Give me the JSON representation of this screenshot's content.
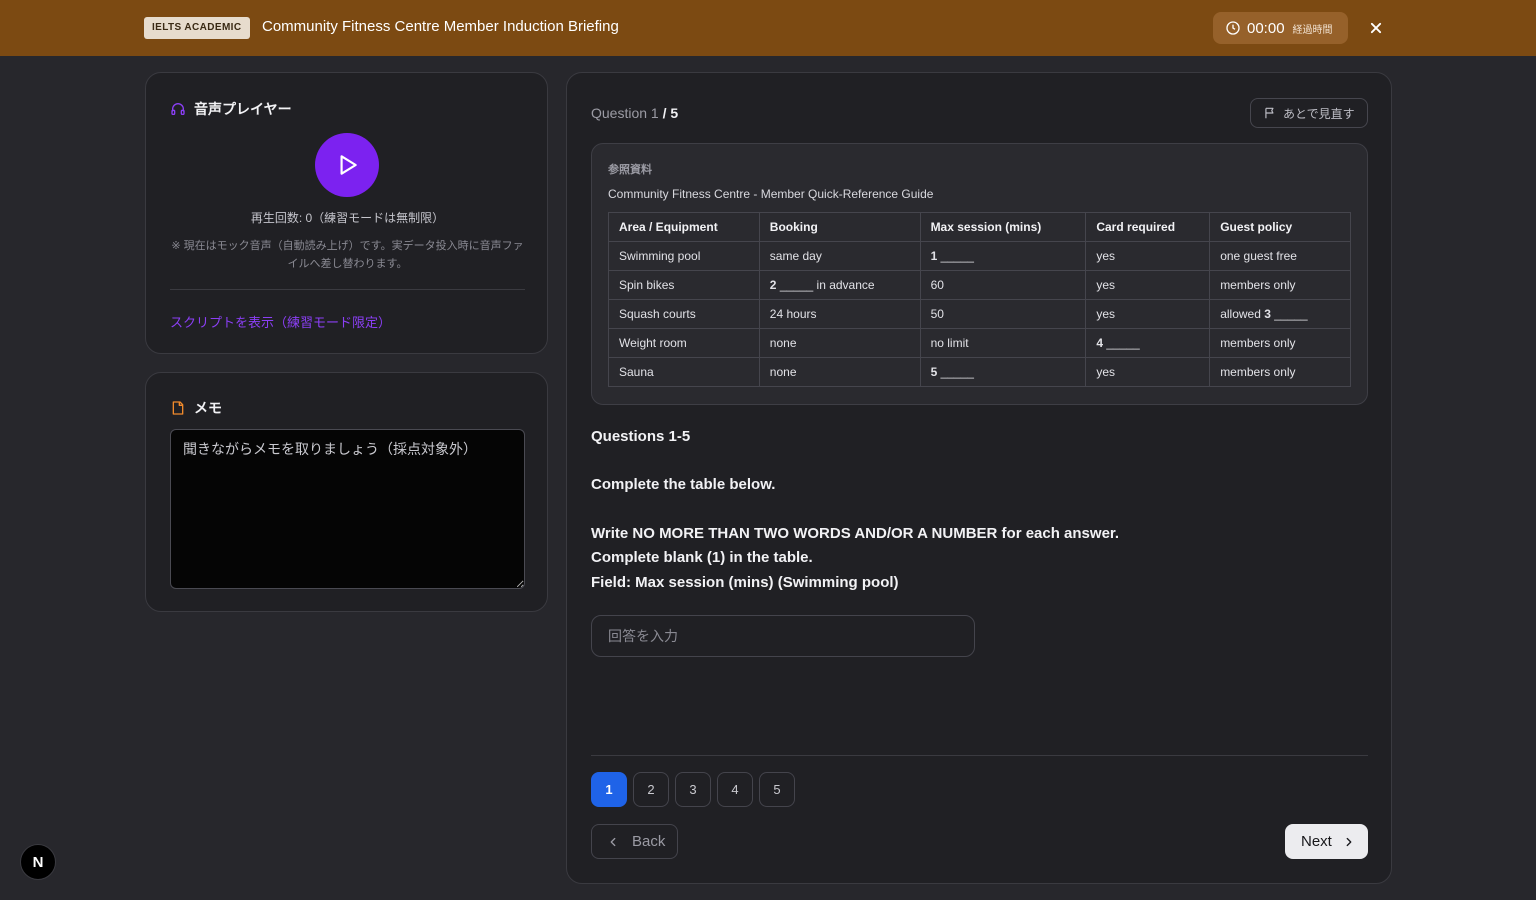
{
  "header": {
    "badge": "IELTS ACADEMIC",
    "title": "Community Fitness Centre Member Induction Briefing",
    "timer_value": "00:00",
    "timer_label": "経過時間"
  },
  "player": {
    "heading": "音声プレイヤー",
    "play_count": "再生回数: 0（練習モードは無制限）",
    "mock_note": "※ 現在はモック音声（自動読み上げ）です。実データ投入時に音声ファイルへ差し替わります。",
    "script_link": "スクリプトを表示（練習モード限定）"
  },
  "memo": {
    "heading": "メモ",
    "placeholder": "聞きながらメモを取りましょう（採点対象外）"
  },
  "question": {
    "counter_current": "Question 1",
    "counter_total": " / 5",
    "review_label": "あとで見直す",
    "reference_label": "参照資料",
    "reference_title": "Community Fitness Centre - Member Quick-Reference Guide",
    "table": {
      "headers": [
        "Area / Equipment",
        "Booking",
        "Max session (mins)",
        "Card required",
        "Guest policy"
      ],
      "rows": [
        [
          {
            "t": "Swimming pool"
          },
          {
            "t": "same day"
          },
          {
            "n": "1",
            "t": " _____"
          },
          {
            "t": "yes"
          },
          {
            "t": "one guest free"
          }
        ],
        [
          {
            "t": "Spin bikes"
          },
          {
            "n": "2",
            "t": " _____ in advance"
          },
          {
            "t": "60"
          },
          {
            "t": "yes"
          },
          {
            "t": "members only"
          }
        ],
        [
          {
            "t": "Squash courts"
          },
          {
            "t": "24 hours"
          },
          {
            "t": "50"
          },
          {
            "t": "yes"
          },
          {
            "p": "allowed ",
            "n": "3",
            "t": " _____"
          }
        ],
        [
          {
            "t": "Weight room"
          },
          {
            "t": "none"
          },
          {
            "t": "no limit"
          },
          {
            "n": "4",
            "t": " _____"
          },
          {
            "t": "members only"
          }
        ],
        [
          {
            "t": "Sauna"
          },
          {
            "t": "none"
          },
          {
            "n": "5",
            "t": " _____"
          },
          {
            "t": "yes"
          },
          {
            "t": "members only"
          }
        ]
      ]
    },
    "heading": "Questions 1-5",
    "instruction_1": "Complete the table below.",
    "instruction_2": "Write NO MORE THAN TWO WORDS AND/OR A NUMBER for each answer.",
    "instruction_3": "Complete blank (1) in the table.",
    "instruction_4": "Field: Max session (mins) (Swimming pool)",
    "answer_placeholder": "回答を入力",
    "pages": [
      "1",
      "2",
      "3",
      "4",
      "5"
    ],
    "active_page": "1",
    "back_label": "Back",
    "next_label": "Next"
  },
  "dev_badge": "N",
  "colors": {
    "header_bg": "#7c4a12",
    "accent_purple": "#7c22f0",
    "active_blue": "#1f63e8",
    "memo_icon": "#f08a2c"
  }
}
